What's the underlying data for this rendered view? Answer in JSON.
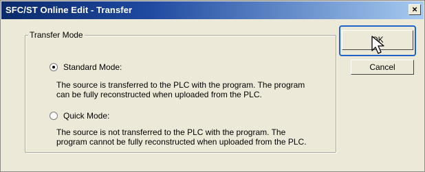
{
  "window": {
    "title": "SFC/ST Online Edit - Transfer",
    "close_label": "×"
  },
  "group": {
    "legend": "Transfer Mode"
  },
  "standard": {
    "label": "Standard Mode:",
    "desc_line1": "The source is transferred to the PLC with the program. The program",
    "desc_line2": "can be fully reconstructed when uploaded from the PLC."
  },
  "quick": {
    "label": "Quick Mode:",
    "desc_line1": "The source is not transferred to the PLC with the program. The",
    "desc_line2": "program cannot be fully reconstructed when uploaded from the PLC."
  },
  "buttons": {
    "ok": "OK",
    "cancel": "Cancel"
  },
  "icons": {
    "cursor": "mouse-pointer-icon"
  }
}
